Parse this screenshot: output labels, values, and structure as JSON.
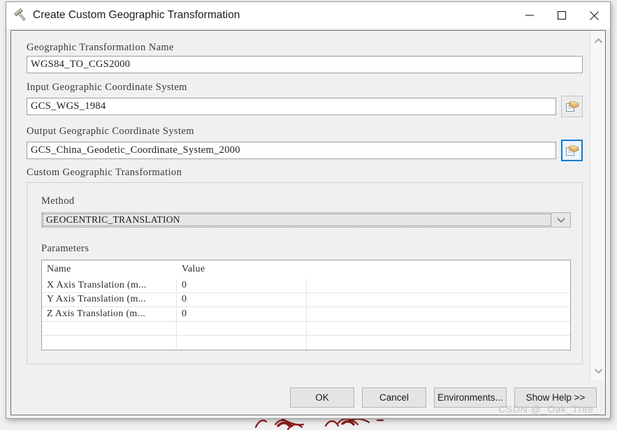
{
  "window": {
    "title": "Create Custom Geographic Transformation",
    "icon": "hammer-tool-icon",
    "minimize_label": "—",
    "maximize_label": "□",
    "close_label": "✕"
  },
  "form": {
    "name_label": "Geographic Transformation Name",
    "name_value": "WGS84_TO_CGS2000",
    "input_gcs_label": "Input Geographic Coordinate System",
    "input_gcs_value": "GCS_WGS_1984",
    "output_gcs_label": "Output Geographic Coordinate System",
    "output_gcs_value": "GCS_China_Geodetic_Coordinate_System_2000",
    "browse_icon": "folder-open-icon",
    "custom_transformation_label": "Custom Geographic Transformation"
  },
  "method": {
    "label": "Method",
    "selected": "GEOCENTRIC_TRANSLATION",
    "dropdown_icon": "chevron-down-icon"
  },
  "parameters": {
    "label": "Parameters",
    "columns": [
      "Name",
      "Value",
      ""
    ],
    "rows": [
      {
        "name": "X Axis Translation (m...",
        "value": "0"
      },
      {
        "name": "Y Axis Translation (m...",
        "value": "0"
      },
      {
        "name": "Z Axis Translation (m...",
        "value": "0"
      }
    ],
    "empty_rows": 2
  },
  "scrollbar": {
    "up_icon": "chevron-up-icon",
    "down_icon": "chevron-down-icon"
  },
  "footer": {
    "ok": "OK",
    "cancel": "Cancel",
    "environments": "Environments...",
    "show_help": "Show Help >>"
  },
  "watermark": {
    "text": "CSDN @_Oak_Tree_"
  },
  "colors": {
    "focus_blue": "#0a7bd4",
    "window_bg": "#f0f0f0",
    "field_bg": "#ffffff",
    "ink_red": "#8b1a1a"
  }
}
